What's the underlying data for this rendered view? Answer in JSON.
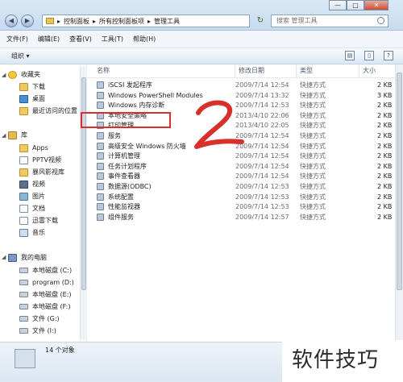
{
  "window": {
    "minimize": "—",
    "maximize": "□",
    "close": "✕"
  },
  "address": {
    "segments": [
      "控制面板",
      "所有控制面板项",
      "管理工具"
    ],
    "separator": "▸"
  },
  "search": {
    "placeholder": "搜索 管理工具"
  },
  "menu": [
    "文件(F)",
    "编辑(E)",
    "查看(V)",
    "工具(T)",
    "帮助(H)"
  ],
  "toolbar": {
    "organize": "组织 ▾"
  },
  "nav": {
    "favorites": "收藏夹",
    "favorites_items": [
      "下载",
      "桌面",
      "最近访问的位置"
    ],
    "libraries": "库",
    "library_items": [
      "Apps",
      "PPTV视频",
      "暴风影视库",
      "视频",
      "图片",
      "文档",
      "迅雷下载",
      "音乐"
    ],
    "computer": "我的电脑",
    "drives": [
      "本地磁盘 (C:)",
      "program (D:)",
      "本地磁盘 (E:)",
      "本地磁盘 (F:)",
      "文件 (G:)",
      "文件 (I:)"
    ]
  },
  "columns": {
    "name": "名称",
    "date": "修改日期",
    "type": "类型",
    "size": "大小"
  },
  "files": [
    {
      "name": "iSCSI 发起程序",
      "date": "2009/7/14 12:54",
      "type": "快捷方式",
      "size": "2 KB"
    },
    {
      "name": "Windows PowerShell Modules",
      "date": "2009/7/14 13:32",
      "type": "快捷方式",
      "size": "3 KB"
    },
    {
      "name": "Windows 内存诊断",
      "date": "2009/7/14 12:53",
      "type": "快捷方式",
      "size": "2 KB"
    },
    {
      "name": "本地安全策略",
      "date": "2013/4/10 22:06",
      "type": "快捷方式",
      "size": "2 KB"
    },
    {
      "name": "打印管理",
      "date": "2013/4/10 22:05",
      "type": "快捷方式",
      "size": "2 KB"
    },
    {
      "name": "服务",
      "date": "2009/7/14 12:54",
      "type": "快捷方式",
      "size": "2 KB"
    },
    {
      "name": "高级安全 Windows 防火墙",
      "date": "2009/7/14 12:54",
      "type": "快捷方式",
      "size": "2 KB"
    },
    {
      "name": "计算机管理",
      "date": "2009/7/14 12:54",
      "type": "快捷方式",
      "size": "2 KB"
    },
    {
      "name": "任务计划程序",
      "date": "2009/7/14 12:54",
      "type": "快捷方式",
      "size": "2 KB"
    },
    {
      "name": "事件查看器",
      "date": "2009/7/14 12:54",
      "type": "快捷方式",
      "size": "2 KB"
    },
    {
      "name": "数据源(ODBC)",
      "date": "2009/7/14 12:53",
      "type": "快捷方式",
      "size": "2 KB"
    },
    {
      "name": "系统配置",
      "date": "2009/7/14 12:53",
      "type": "快捷方式",
      "size": "2 KB"
    },
    {
      "name": "性能监视器",
      "date": "2009/7/14 12:53",
      "type": "快捷方式",
      "size": "2 KB"
    },
    {
      "name": "组件服务",
      "date": "2009/7/14 12:57",
      "type": "快捷方式",
      "size": "2 KB"
    }
  ],
  "status": {
    "count": "14 个对象"
  },
  "watermark": "软件技巧",
  "annotation": {
    "color": "#d8312b"
  }
}
